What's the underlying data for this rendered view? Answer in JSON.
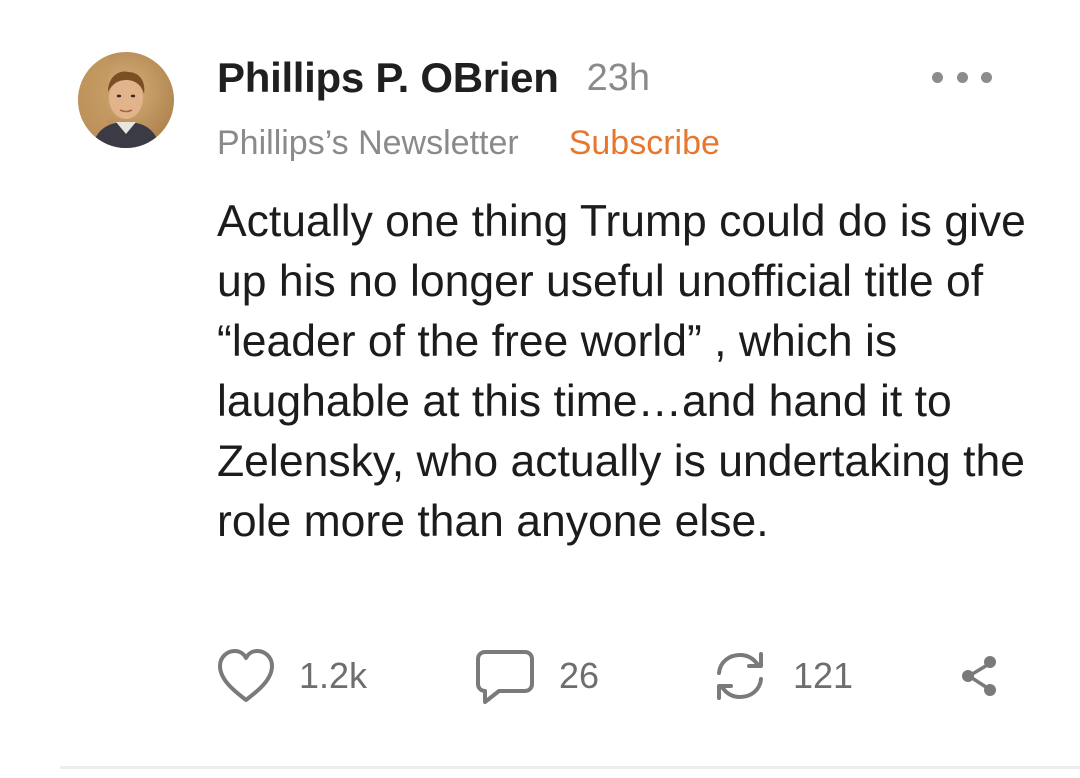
{
  "author": {
    "name": "Phillips P. OBrien",
    "timestamp": "23h",
    "avatar": "author-avatar-photo"
  },
  "publication": {
    "name": "Phillips’s Newsletter",
    "subscribe_label": "Subscribe"
  },
  "post": {
    "text": "Actually one thing Trump could do is give up his no longer useful unofficial title of “leader of the free world” , which is laughable at this time…and hand it to Zelensky, who actually is undertaking the role more than anyone else."
  },
  "actions": {
    "like": {
      "icon": "heart-icon",
      "count": "1.2k"
    },
    "comment": {
      "icon": "comment-icon",
      "count": "26"
    },
    "restack": {
      "icon": "restack-icon",
      "count": "121"
    },
    "share": {
      "icon": "share-icon"
    }
  },
  "menu": {
    "icon": "more-icon"
  },
  "colors": {
    "accent": "#e8772e",
    "text": "#1c1c1c",
    "muted": "#8a8a8a",
    "icon": "#7a7a7a"
  }
}
